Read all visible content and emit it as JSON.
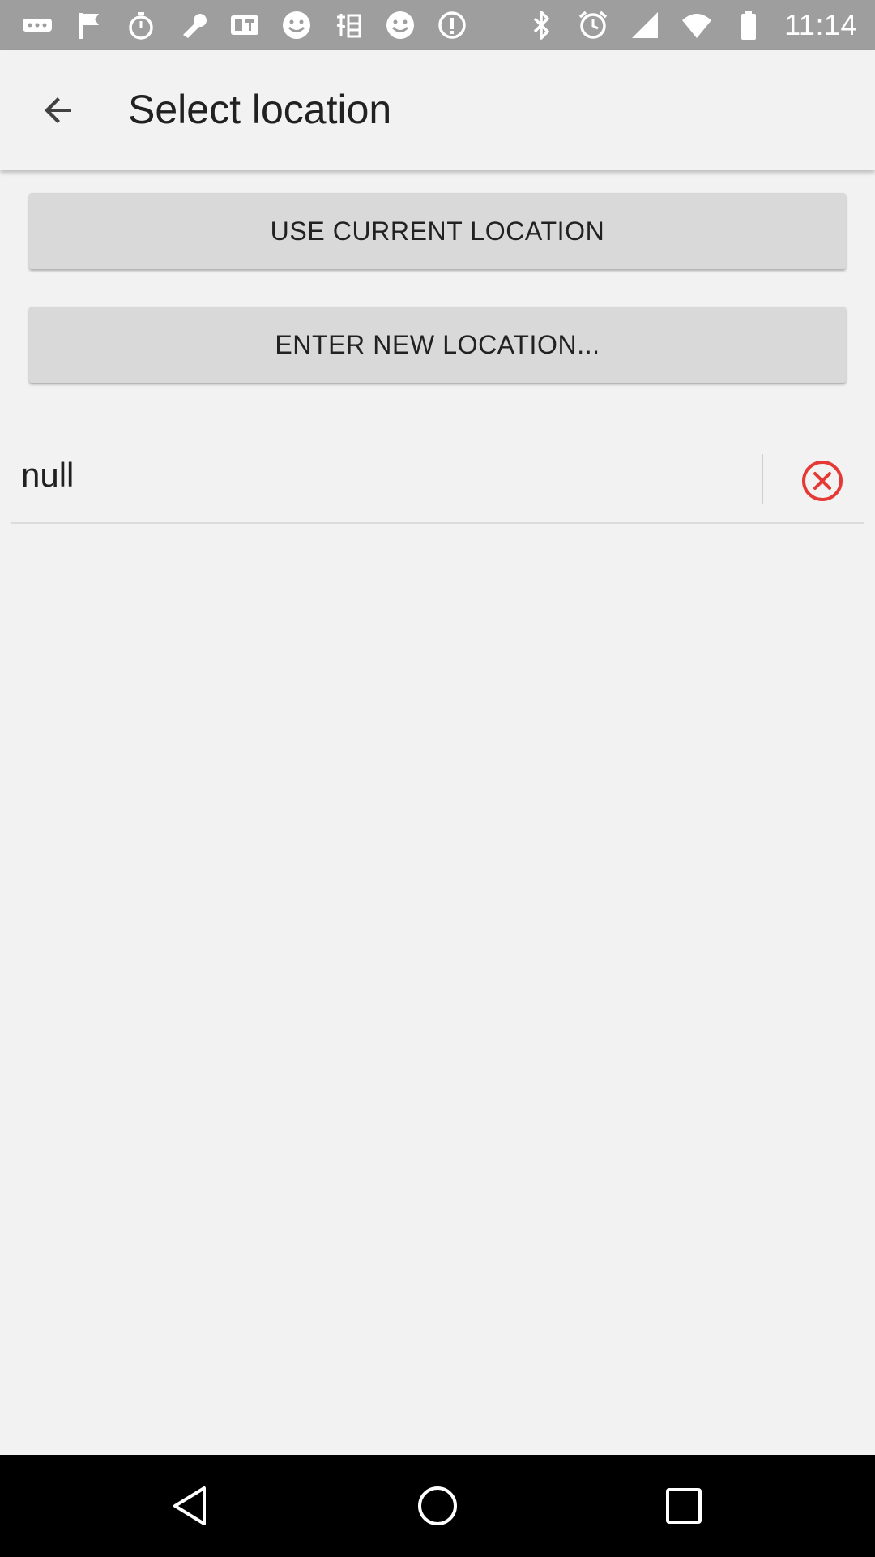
{
  "status_bar": {
    "time": "11:14",
    "left_icons": [
      "more-dots-icon",
      "flag-icon",
      "stopwatch-icon",
      "wrench-icon",
      "qr-app-icon",
      "smiley-icon",
      "chinese-app-icon",
      "smiley-icon",
      "info-icon"
    ],
    "right_icons": [
      "bluetooth-icon",
      "alarm-icon",
      "signal-icon",
      "wifi-icon",
      "battery-icon"
    ]
  },
  "app_bar": {
    "title": "Select location"
  },
  "buttons": {
    "use_current": "USE CURRENT LOCATION",
    "enter_new": "ENTER NEW LOCATION..."
  },
  "locations": [
    {
      "name": "null"
    }
  ],
  "colors": {
    "background": "#f2f2f2",
    "button": "#d9d9d9",
    "remove_icon": "#e53935",
    "status_bar": "#9e9e9e",
    "nav_bar": "#000000"
  }
}
